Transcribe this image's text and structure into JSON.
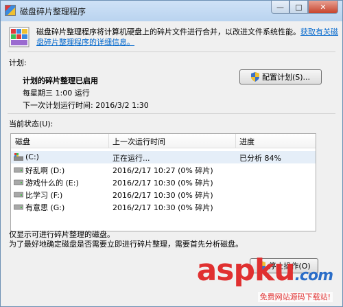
{
  "window": {
    "title": "磁盘碎片整理程序",
    "controls": {
      "minimize": "—",
      "maximize": "□",
      "close": "✕"
    }
  },
  "intro": {
    "text": "磁盘碎片整理程序将计算机硬盘上的碎片文件进行合并，以改进文件系统性能。",
    "link": "获取有关磁盘碎片整理程序的详细信息。"
  },
  "schedule": {
    "section_label": "计划:",
    "status": "计划的碎片整理已启用",
    "runs": "每星期三 1:00 运行",
    "next_run": "下一次计划运行时间: 2016/3/2 1:30",
    "configure_button": "配置计划(S)..."
  },
  "current_status": {
    "section_label": "当前状态(U):",
    "columns": [
      "磁盘",
      "上一次运行时间",
      "进度"
    ],
    "rows": [
      {
        "disk": "(C:)",
        "last_run": "正在运行...",
        "progress": "已分析 84%",
        "icon": "system-drive-icon"
      },
      {
        "disk": "好乱啊 (D:)",
        "last_run": "2016/2/17 10:27 (0% 碎片)",
        "progress": "",
        "icon": "drive-icon"
      },
      {
        "disk": "游戏什么的 (E:)",
        "last_run": "2016/2/17 10:30 (0% 碎片)",
        "progress": "",
        "icon": "drive-icon"
      },
      {
        "disk": "比学习 (F:)",
        "last_run": "2016/2/17 10:30 (0% 碎片)",
        "progress": "",
        "icon": "drive-icon"
      },
      {
        "disk": "有意思 (G:)",
        "last_run": "2016/2/17 10:30 (0% 碎片)",
        "progress": "",
        "icon": "drive-icon"
      }
    ]
  },
  "notes": {
    "line1": "仅显示可进行碎片整理的磁盘。",
    "line2": "为了最好地确定磁盘是否需要立即进行碎片整理，需要首先分析磁盘。"
  },
  "stop_button": "停止操作(O)",
  "watermark": {
    "main": "aspku",
    "suffix": ".com",
    "sub": "免费网站源码下载站!"
  },
  "colors": {
    "link": "#0066cc",
    "titlebar": "#b9d3ef",
    "watermark_red": "#e03030"
  }
}
